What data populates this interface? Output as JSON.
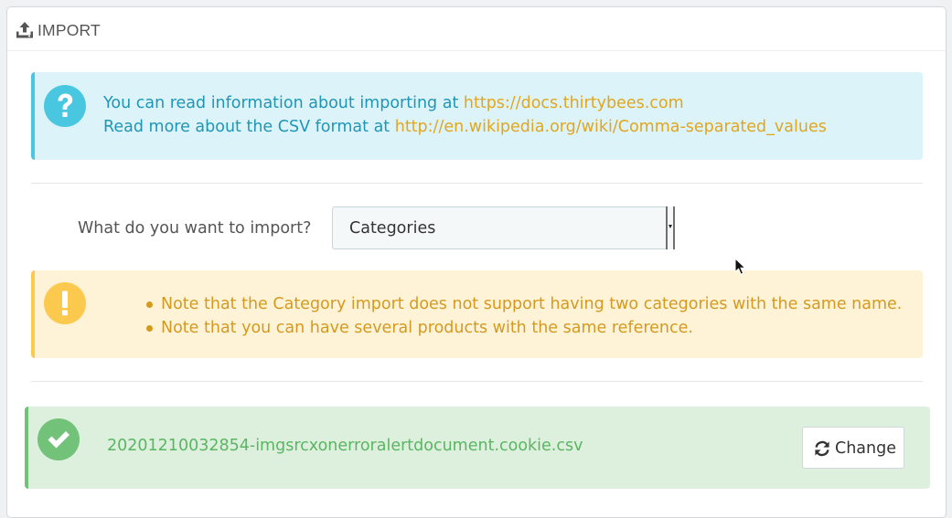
{
  "header": {
    "title": "IMPORT",
    "icon": "upload-icon"
  },
  "info_alert": {
    "icon": "question-circle-icon",
    "line1_text": "You can read information about importing at ",
    "line1_link": "https://docs.thirtybees.com",
    "line2_text": "Read more about the CSV format at ",
    "line2_link": "http://en.wikipedia.org/wiki/Comma-separated_values"
  },
  "import_form": {
    "label": "What do you want to import?",
    "selected": "Categories"
  },
  "warning_alert": {
    "icon": "exclamation-circle-icon",
    "notes": [
      "Note that the Category import does not support having two categories with the same name.",
      "Note that you can have several products with the same reference."
    ]
  },
  "file_alert": {
    "icon": "check-circle-icon",
    "filename": "20201210032854-imgsrcxonerroralertdocument.cookie.csv",
    "change_label": "Change",
    "change_icon": "refresh-icon"
  },
  "colors": {
    "info_bg": "#dcf4f9",
    "info_text": "#1f96b6",
    "link": "#e0a620",
    "warning_bg": "#fff3d7",
    "warning_text": "#d49a1f",
    "success_bg": "#ddf0de",
    "success_text": "#5bb562"
  }
}
